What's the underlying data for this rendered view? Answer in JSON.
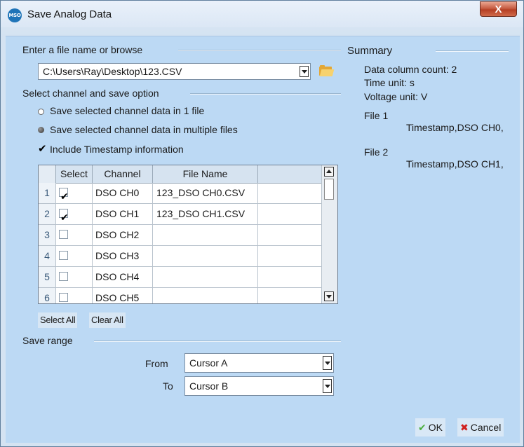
{
  "window": {
    "title": "Save Analog Data",
    "app_icon_text": "MSO",
    "close_glyph": "X",
    "close_icon": "close-icon"
  },
  "file": {
    "section_label": "Enter a file name or browse",
    "path_value": "C:\\Users\\Ray\\Desktop\\123.CSV",
    "browse_icon": "folder-open-icon"
  },
  "channels": {
    "section_label": "Select channel and save option",
    "option_single_file": "Save selected channel data in 1 file",
    "option_multiple_files": "Save selected channel data in multiple files",
    "selected_option": "multiple",
    "include_timestamp": "Include Timestamp information",
    "include_timestamp_checked": true,
    "grid": {
      "headers": [
        "Select",
        "Channel",
        "File Name"
      ],
      "rows": [
        {
          "num": "1",
          "checked": true,
          "channel": "DSO CH0",
          "file_name": "123_DSO CH0.CSV"
        },
        {
          "num": "2",
          "checked": true,
          "channel": "DSO CH1",
          "file_name": "123_DSO CH1.CSV"
        },
        {
          "num": "3",
          "checked": false,
          "channel": "DSO CH2",
          "file_name": ""
        },
        {
          "num": "4",
          "checked": false,
          "channel": "DSO CH3",
          "file_name": ""
        },
        {
          "num": "5",
          "checked": false,
          "channel": "DSO CH4",
          "file_name": ""
        },
        {
          "num": "6",
          "checked": false,
          "channel": "DSO CH5",
          "file_name": ""
        }
      ]
    },
    "select_all_label": "Select All",
    "clear_all_label": "Clear All"
  },
  "save_range": {
    "section_label": "Save range",
    "from_label": "From",
    "from_value": "Cursor A",
    "to_label": "To",
    "to_value": "Cursor B"
  },
  "summary": {
    "title": "Summary",
    "data_column_count": "Data column count: 2",
    "time_unit": "Time unit: s",
    "voltage_unit": "Voltage unit: V",
    "files": [
      {
        "label": "File 1",
        "columns": "Timestamp,DSO CH0,"
      },
      {
        "label": "File 2",
        "columns": "Timestamp,DSO CH1,"
      }
    ]
  },
  "buttons": {
    "ok_label": "OK",
    "ok_icon": "checkmark-icon",
    "cancel_label": "Cancel",
    "cancel_icon": "x-icon"
  },
  "colors": {
    "client_background": "#bcd9f4",
    "title_background": "#dbe7f5",
    "close_button": "#c75d43",
    "ok_icon": "#4caf3f",
    "cancel_icon": "#d0211f"
  }
}
